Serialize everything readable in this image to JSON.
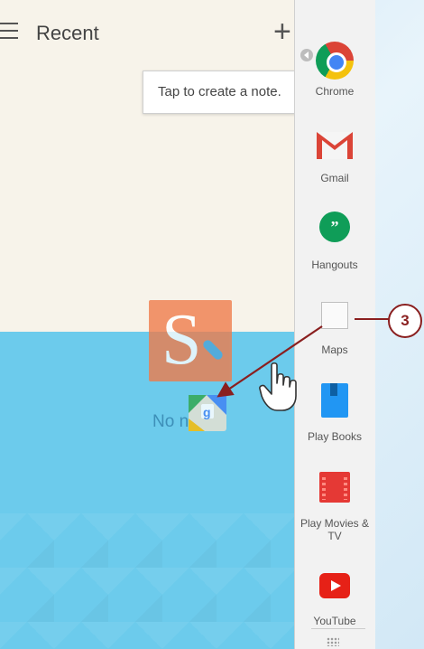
{
  "app": {
    "title": "Recent",
    "add_label": "+",
    "tooltip": "Tap to create a note.",
    "empty_text": "No n"
  },
  "drawer": {
    "items": [
      {
        "label": "Chrome",
        "icon": "chrome-icon"
      },
      {
        "label": "Gmail",
        "icon": "gmail-icon"
      },
      {
        "label": "Hangouts",
        "icon": "hangouts-icon"
      },
      {
        "label": "Maps",
        "icon": "maps-placeholder-icon"
      },
      {
        "label": "Play Books",
        "icon": "playbooks-icon"
      },
      {
        "label": "Play Movies & TV",
        "icon": "playmovies-icon"
      },
      {
        "label": "YouTube",
        "icon": "youtube-icon"
      }
    ]
  },
  "callout": {
    "number": "3"
  },
  "colors": {
    "callout": "#8a1f1f",
    "app_bottom": "#6ccbec",
    "app_top": "#f7f3ea",
    "drawer": "#f2f2f2"
  }
}
